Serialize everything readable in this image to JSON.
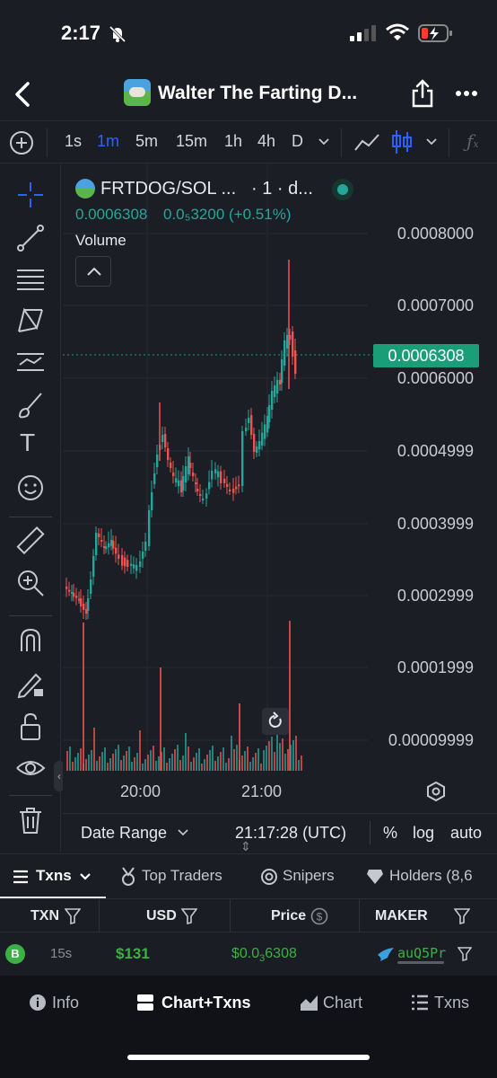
{
  "status": {
    "time": "2:17"
  },
  "nav": {
    "title": "Walter The Farting D..."
  },
  "toolbar": {
    "timeframes": [
      "1s",
      "1m",
      "5m",
      "15m",
      "1h",
      "4h",
      "D"
    ],
    "active_timeframe": "1m"
  },
  "chart": {
    "pair": "FRTDOG/SOL ...",
    "interval": "· 1 · d...",
    "price": "0.0006308",
    "change": "0.0₅3200 (+0.51%)",
    "volume_label": "Volume",
    "current_price_tag": "0.0006308",
    "y_labels": [
      "0.0008000",
      "0.0007000",
      "0.0006000",
      "0.0004999",
      "0.0003999",
      "0.0002999",
      "0.0001999",
      "0.00009999"
    ],
    "x_labels": [
      "20:00",
      "21:00"
    ],
    "colors": {
      "up": "#26a69a",
      "down": "#ef5350",
      "price_tag": "#1a9e78",
      "accent": "#2962ff"
    }
  },
  "chart_footer": {
    "date_range": "Date Range",
    "time": "21:17:28 (UTC)",
    "percent": "%",
    "log": "log",
    "auto": "auto"
  },
  "tabs": [
    "Txns",
    "Top Traders",
    "Snipers",
    "Holders (8,6"
  ],
  "table": {
    "headers": [
      "TXN",
      "USD",
      "Price",
      "MAKER"
    ],
    "row": {
      "type": "B",
      "age": "15s",
      "usd": "$131",
      "price_prefix": "$0.0",
      "price_sub": "3",
      "price_tail": "6308",
      "maker": "auQ5Pr"
    }
  },
  "bottom_nav": [
    "Info",
    "Chart+Txns",
    "Chart",
    "Txns"
  ]
}
